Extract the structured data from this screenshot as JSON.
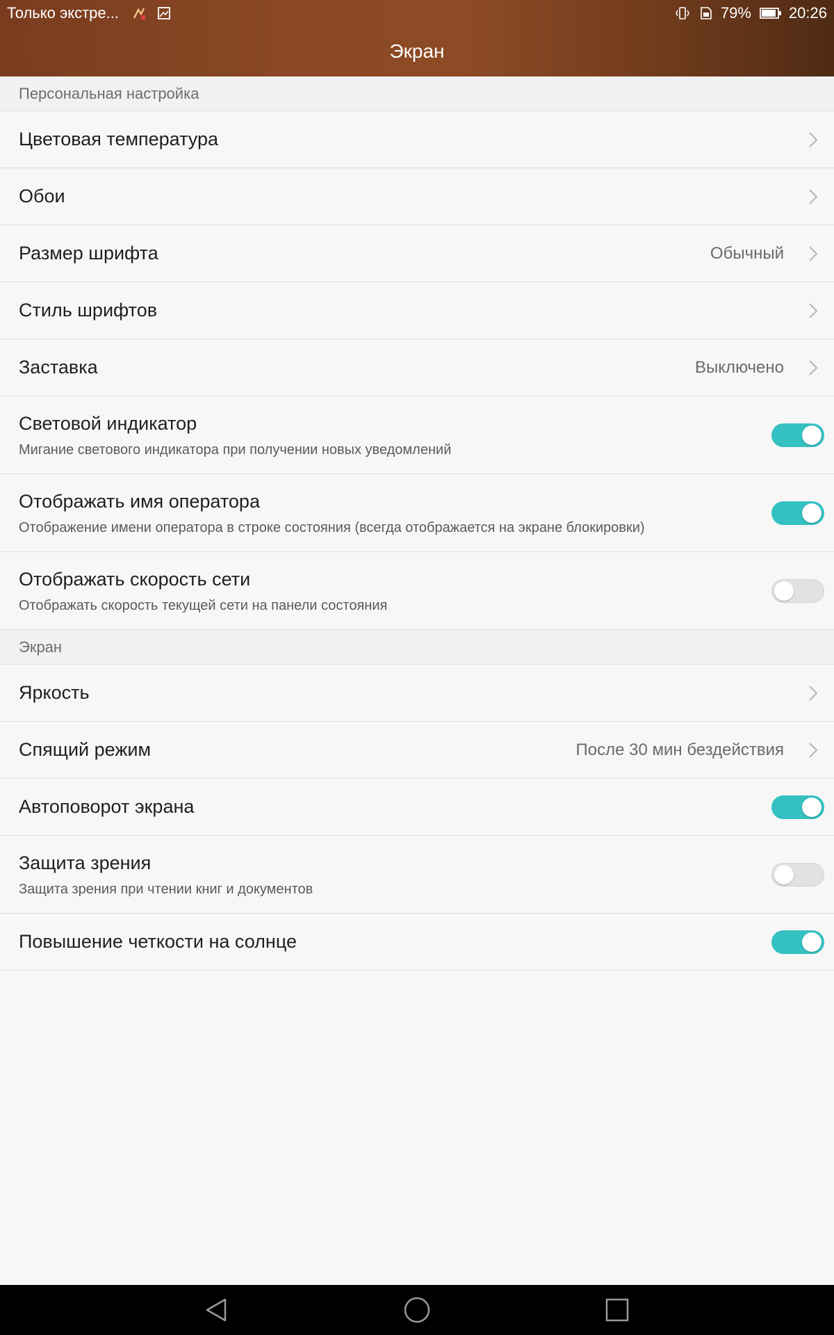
{
  "status_bar": {
    "carrier": "Только экстре...",
    "battery_percent": "79%",
    "time": "20:26",
    "left_icons": [
      "notification-app-icon",
      "image-icon"
    ],
    "right_icons": [
      "vibrate-icon",
      "sim-icon",
      "battery-icon"
    ]
  },
  "header": {
    "title": "Экран"
  },
  "sections": {
    "personal": "Персональная настройка",
    "screen": "Экран"
  },
  "items": {
    "color_temp": {
      "label": "Цветовая температура"
    },
    "wallpaper": {
      "label": "Обои"
    },
    "font_size": {
      "label": "Размер шрифта",
      "value": "Обычный"
    },
    "font_style": {
      "label": "Стиль шрифтов"
    },
    "screensaver": {
      "label": "Заставка",
      "value": "Выключено"
    },
    "indicator": {
      "label": "Световой индикатор",
      "sub": "Мигание светового индикатора при получении новых уведомлений",
      "on": true
    },
    "operator_name": {
      "label": "Отображать имя оператора",
      "sub": "Отображение имени оператора в строке состояния (всегда отображается на экране блокировки)",
      "on": true
    },
    "net_speed": {
      "label": "Отображать скорость сети",
      "sub": "Отображать скорость текущей сети на панели состояния",
      "on": false
    },
    "brightness": {
      "label": "Яркость"
    },
    "sleep": {
      "label": "Спящий режим",
      "value": "После 30 мин бездействия"
    },
    "autorotate": {
      "label": "Автоповорот экрана",
      "on": true
    },
    "eye_protect": {
      "label": "Защита зрения",
      "sub": "Защита зрения при чтении книг и документов",
      "on": false
    },
    "sunlight": {
      "label": "Повышение четкости на солнце",
      "on": true
    }
  },
  "colors": {
    "accent": "#35c1c2",
    "header_brown": "#8a4824"
  },
  "nav_bar": {
    "icons": [
      "back-icon",
      "home-icon",
      "recents-icon"
    ]
  }
}
